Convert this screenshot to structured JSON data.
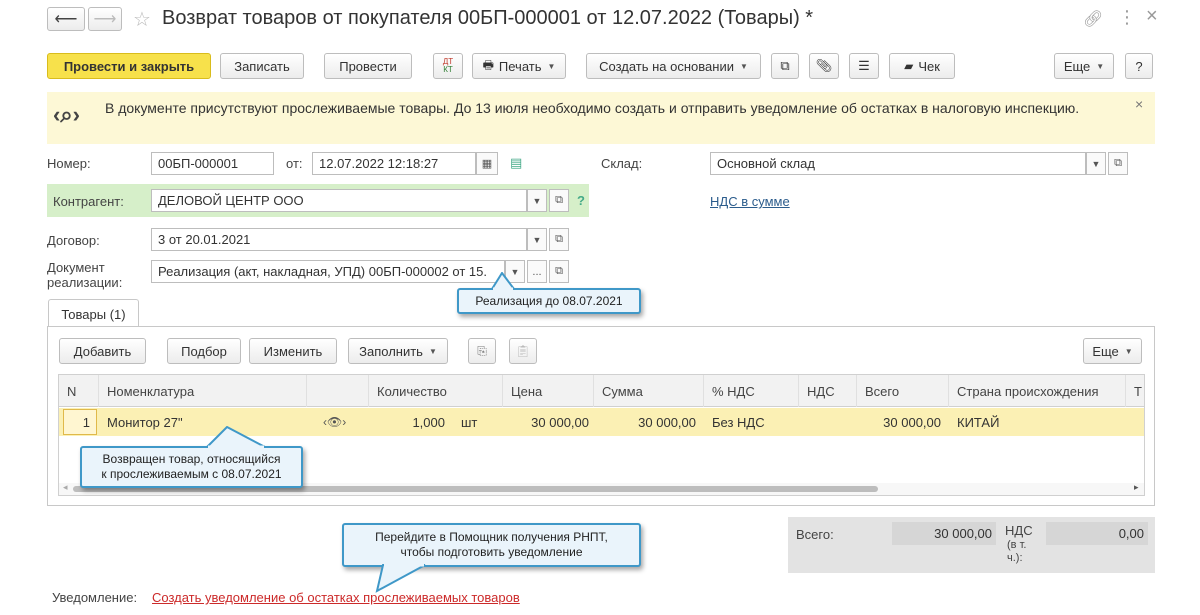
{
  "window": {
    "title": "Возврат товаров от покупателя 00БП-000001 от 12.07.2022 (Товары) *"
  },
  "toolbar": {
    "post_close": "Провести и закрыть",
    "save": "Записать",
    "post": "Провести",
    "dt_kt": "ДТ КТ",
    "print": "Печать",
    "create_based": "Создать на основании",
    "receipt": "Чек",
    "more": "Еще",
    "help": "?"
  },
  "notice": {
    "text": "В документе присутствуют прослеживаемые товары. До 13 июля необходимо создать и отправить уведомление об остатках в налоговую инспекцию.",
    "close": "×"
  },
  "form": {
    "number_label": "Номер:",
    "number_value": "00БП-000001",
    "from_label": "от:",
    "date_value": "12.07.2022 12:18:27",
    "warehouse_label": "Склад:",
    "warehouse_value": "Основной склад",
    "counterparty_label": "Контрагент:",
    "counterparty_value": "ДЕЛОВОЙ ЦЕНТР ООО",
    "counterparty_help": "?",
    "vat_link": "НДС в сумме",
    "contract_label": "Договор:",
    "contract_value": "3 от 20.01.2021",
    "sale_doc_label_line1": "Документ",
    "sale_doc_label_line2": "реализации:",
    "sale_doc_value": "Реализация (акт, накладная, УПД) 00БП-000002 от 15.",
    "dots": "..."
  },
  "callouts": {
    "sale": "Реализация до 08.07.2021",
    "returned_line1": "Возвращен товар, относящийся",
    "returned_line2": "к прослеживаемым с 08.07.2021",
    "assistant_line1": "Перейдите в Помощник получения РНПТ,",
    "assistant_line2": "чтобы подготовить уведомление"
  },
  "tabs": {
    "goods": "Товары (1)"
  },
  "table_toolbar": {
    "add": "Добавить",
    "pick": "Подбор",
    "edit": "Изменить",
    "fill": "Заполнить",
    "more": "Еще"
  },
  "table": {
    "headers": [
      "N",
      "Номенклатура",
      "",
      "Количество",
      "Цена",
      "Сумма",
      "% НДС",
      "НДС",
      "Всего",
      "Страна происхождения",
      "Т"
    ],
    "row": {
      "n": "1",
      "item": "Монитор 27\"",
      "qty": "1,000",
      "unit": "шт",
      "price": "30 000,00",
      "sum": "30 000,00",
      "vat_rate": "Без НДС",
      "vat": "",
      "total": "30 000,00",
      "country": "КИТАЙ"
    }
  },
  "totals": {
    "total_label": "Всего:",
    "total_value": "30 000,00",
    "vat_label_line1": "НДС",
    "vat_label_line2": "(в т.",
    "vat_label_line3": "ч.):",
    "vat_value": "0,00"
  },
  "footer": {
    "notification_label": "Уведомление:",
    "notification_link": "Создать уведомление об остатках прослеживаемых товаров"
  },
  "colors": {
    "primary_button": "#f7e14b",
    "notice_bg": "#fdf8d6",
    "counterparty_bg": "#d6efc9",
    "selected_row": "#fbf0b4",
    "link": "#2b5c8c",
    "red_link": "#cc2a2a",
    "callout_border": "#3f98c8"
  }
}
